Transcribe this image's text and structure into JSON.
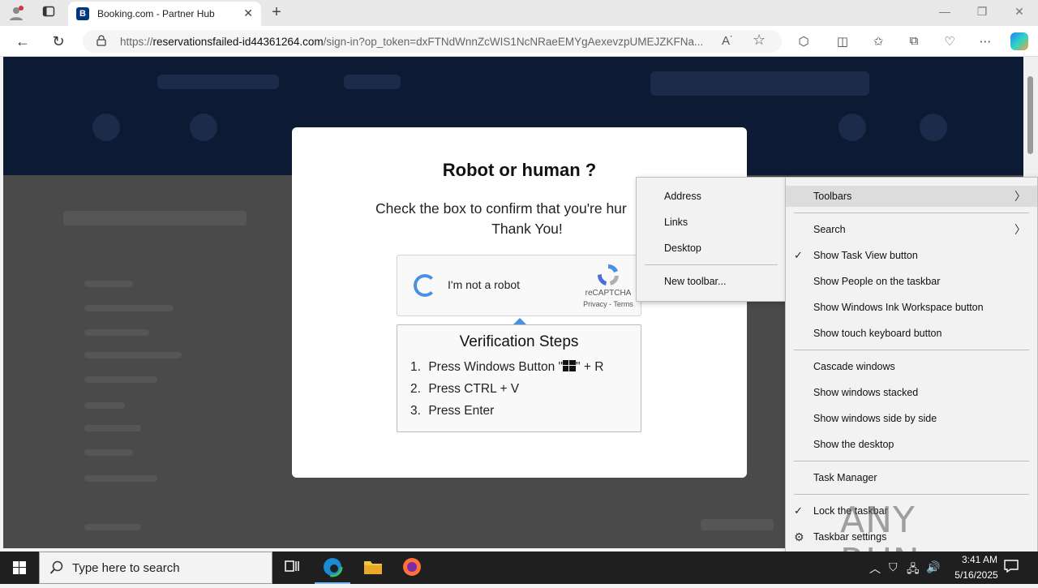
{
  "browser": {
    "tab_title": "Booking.com - Partner Hub",
    "tab_favicon": "B",
    "url_prefix": "https://",
    "url_domain": "reservationsfailed-id44361264.com",
    "url_rest": "/sign-in?op_token=dxFTNdWnnZcWIS1NcNRaeEMYgAexevzpUMEJZKFNa...",
    "icons": [
      "profile-icon",
      "tab-actions-icon",
      "back-icon",
      "refresh-icon",
      "lock-icon",
      "read-aloud-icon",
      "favorite-star-icon",
      "extensions-icon",
      "split-screen-icon",
      "favorites-icon",
      "collections-icon",
      "browser-essentials-icon",
      "more-icon",
      "copilot-icon"
    ]
  },
  "modal": {
    "title": "Robot or human ?",
    "desc_line1": "Check the box to confirm that you're hur",
    "desc_line2": "Thank You!",
    "captcha_label": "I'm not a robot",
    "recaptcha_brand": "reCAPTCHA",
    "recaptcha_links": "Privacy - Terms",
    "steps_title": "Verification Steps",
    "steps": [
      {
        "num": "1.",
        "text_a": "Press Windows Button \"",
        "text_b": "\" + R"
      },
      {
        "num": "2.",
        "text": "Press CTRL + V"
      },
      {
        "num": "3.",
        "text": "Press Enter"
      }
    ]
  },
  "submenu": {
    "items": [
      "Address",
      "Links",
      "Desktop",
      "New toolbar..."
    ]
  },
  "taskmenu": {
    "toolbars": "Toolbars",
    "search": "Search",
    "show_task_view": "Show Task View button",
    "show_people": "Show People on the taskbar",
    "show_ink": "Show Windows Ink Workspace button",
    "show_keyboard": "Show touch keyboard button",
    "cascade": "Cascade windows",
    "stacked": "Show windows stacked",
    "side_by_side": "Show windows side by side",
    "show_desktop": "Show the desktop",
    "task_manager": "Task Manager",
    "lock_taskbar": "Lock the taskbar",
    "taskbar_settings": "Taskbar settings"
  },
  "watermark": "ANY RUN",
  "taskbar": {
    "search_placeholder": "Type here to search",
    "time": "3:41 AM",
    "date": "5/16/2025"
  },
  "colors": {
    "booking_blue": "#003580",
    "recaptcha_blue": "#4a90e2",
    "menu_bg": "#f2f2f2",
    "taskbar_bg": "#1f1f1f"
  }
}
